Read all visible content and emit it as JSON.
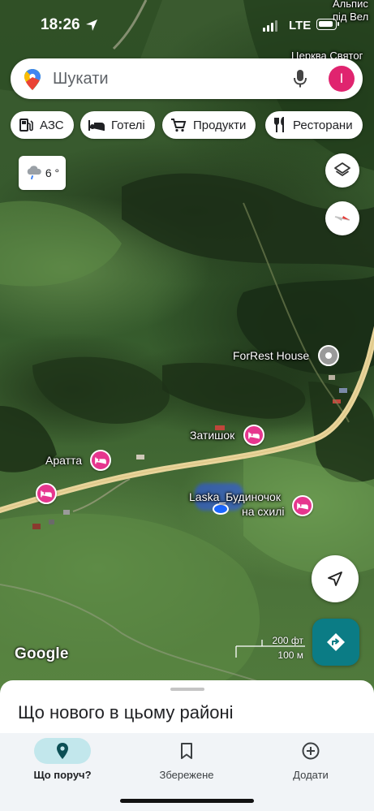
{
  "status_bar": {
    "time": "18:26",
    "network": "LTE"
  },
  "search": {
    "placeholder": "Шукати",
    "avatar_letter": "І"
  },
  "chips": [
    {
      "label": "АЗС",
      "icon": "gas-station-icon"
    },
    {
      "label": "Готелі",
      "icon": "bed-icon"
    },
    {
      "label": "Продукти",
      "icon": "cart-icon"
    },
    {
      "label": "Ресторани",
      "icon": "cutlery-icon"
    }
  ],
  "weather": {
    "temp": "6 °",
    "icon": "cloud-rain-icon"
  },
  "map": {
    "labels": {
      "top_right_1": "Альпис",
      "top_right_2": "під Вел",
      "church": "Церква Святог",
      "forrest": "ForRest House",
      "zatyshok": "Затишок",
      "aratta": "Аратта",
      "laska_1": "Laska_Будиночок",
      "laska_2": "на схилі"
    },
    "scale": {
      "feet": "200 фт",
      "meters": "100 м"
    },
    "attribution": "Google"
  },
  "bottom_sheet": {
    "title": "Що нового в цьому районі"
  },
  "nav": [
    {
      "label": "Що поруч?",
      "icon": "explore-pin-icon",
      "active": true
    },
    {
      "label": "Збережене",
      "icon": "bookmark-icon",
      "active": false
    },
    {
      "label": "Додати",
      "icon": "add-circle-icon",
      "active": false
    }
  ],
  "colors": {
    "hotel_pin": "#e6368e",
    "road": "#e8d49a",
    "accent": "#0b7c85",
    "nav_active": "#c2e7ec"
  }
}
